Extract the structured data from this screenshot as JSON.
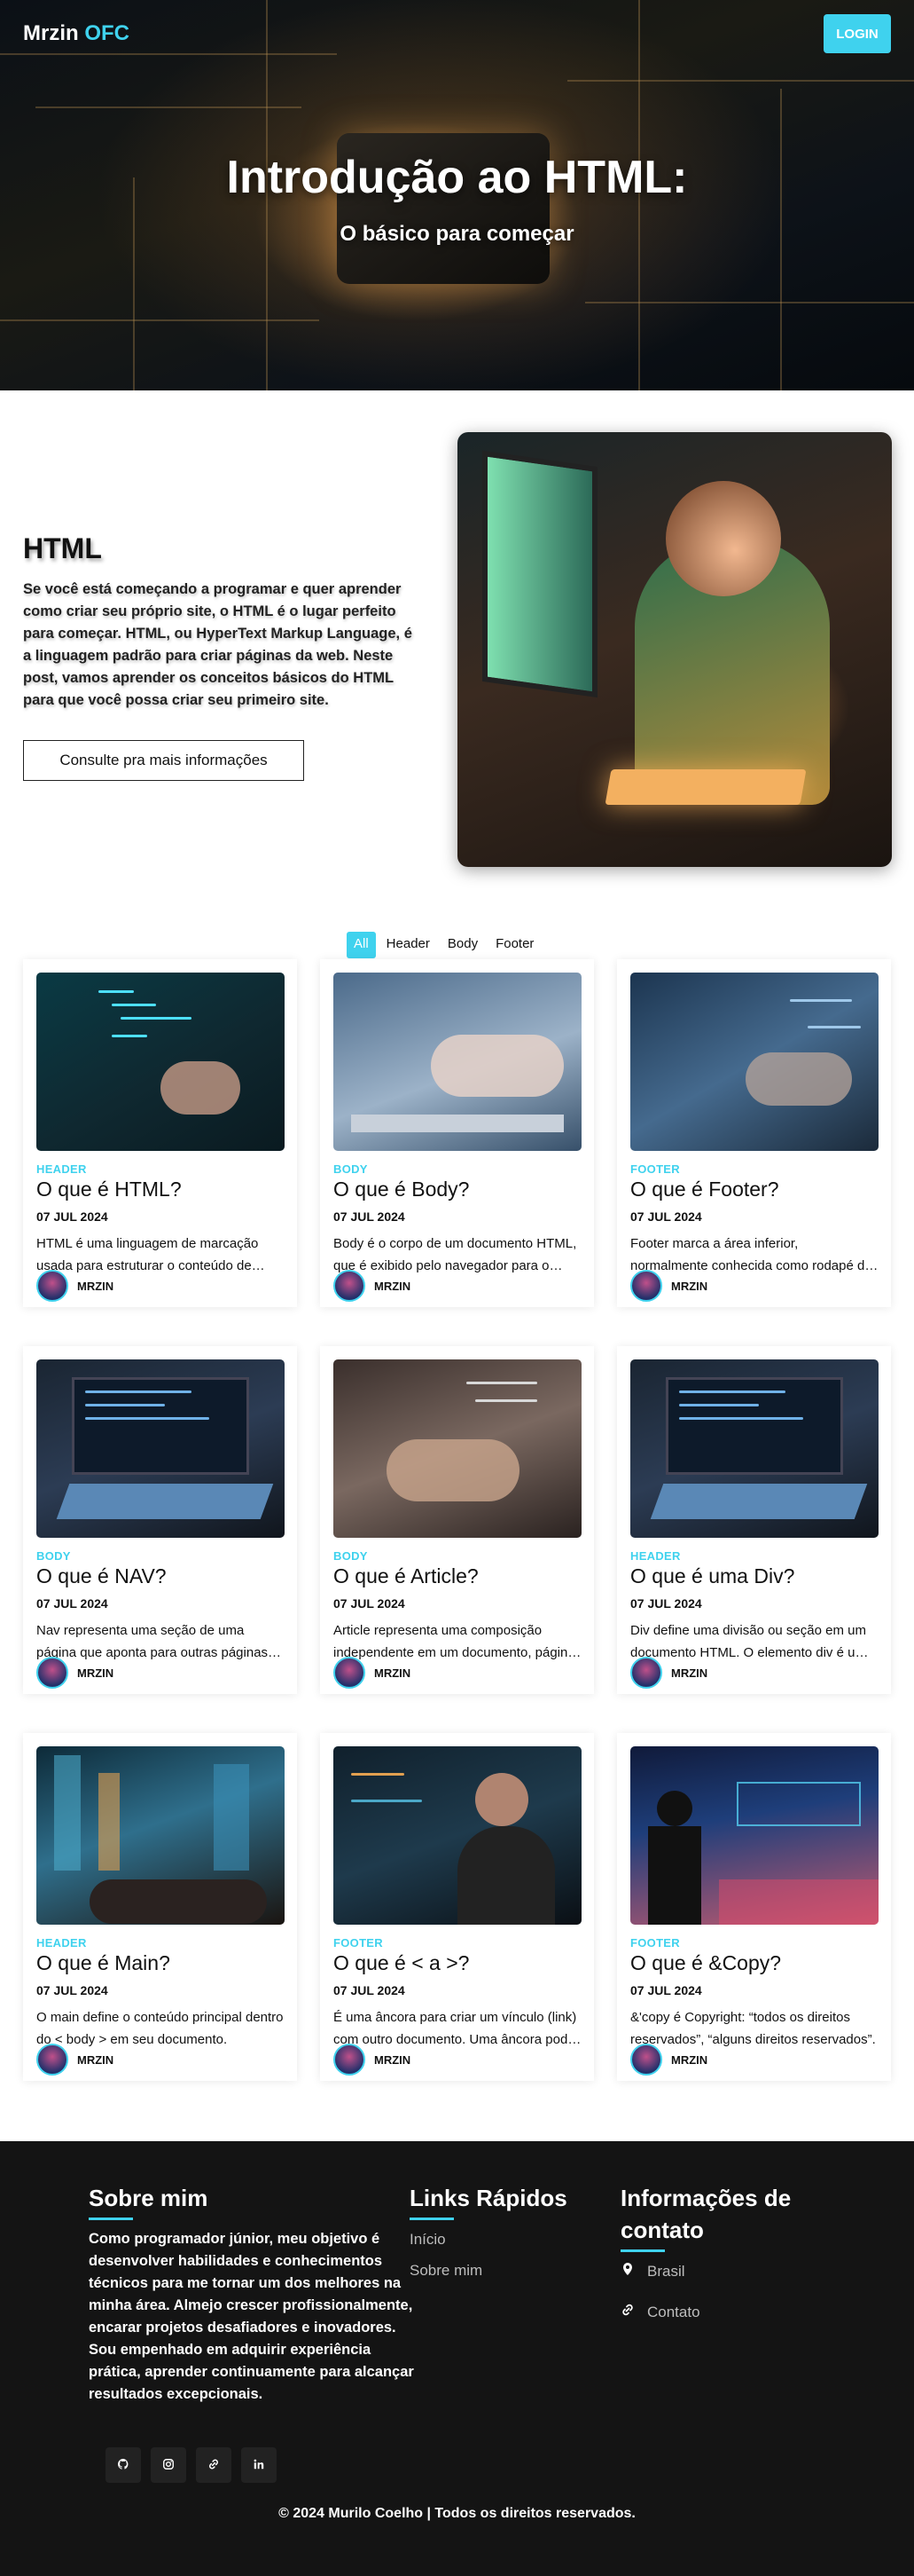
{
  "nav": {
    "brand_main": "Mrzin",
    "brand_accent": "OFC",
    "login_label": "LOGIN"
  },
  "hero": {
    "title": "Introdução ao HTML:",
    "subtitle": "O básico para começar"
  },
  "intro": {
    "heading": "HTML",
    "text": "Se você está começando a programar e quer aprender como criar seu próprio site, o HTML é o lugar perfeito para começar. HTML, ou HyperText Markup Language, é a linguagem padrão para criar páginas da web. Neste post, vamos aprender os conceitos básicos do HTML para que você possa criar seu primeiro site.",
    "button_label": "Consulte pra mais informações"
  },
  "filters": [
    "All",
    "Header",
    "Body",
    "Footer"
  ],
  "active_filter": "All",
  "cards": [
    {
      "category": "HEADER",
      "title": "O que é HTML?",
      "date": "07 JUL 2024",
      "excerpt": "HTML é uma linguagem de marcação usada para estruturar o conteúdo de páginas da web.",
      "author": "MRZIN"
    },
    {
      "category": "BODY",
      "title": "O que é Body?",
      "date": "07 JUL 2024",
      "excerpt": "Body é o corpo de um documento HTML, que é exibido pelo navegador para o usuário.",
      "author": "MRZIN"
    },
    {
      "category": "FOOTER",
      "title": "O que é Footer?",
      "date": "07 JUL 2024",
      "excerpt": "Footer marca a área inferior, normalmente conhecida como rodapé da página.",
      "author": "MRZIN"
    },
    {
      "category": "BODY",
      "title": "O que é NAV?",
      "date": "07 JUL 2024",
      "excerpt": "Nav representa uma seção de uma página que aponta para outras páginas ou seções.",
      "author": "MRZIN"
    },
    {
      "category": "BODY",
      "title": "O que é Article?",
      "date": "07 JUL 2024",
      "excerpt": "Article representa uma composição independente em um documento, página ou site.",
      "author": "MRZIN"
    },
    {
      "category": "HEADER",
      "title": "O que é uma Div?",
      "date": "07 JUL 2024",
      "excerpt": "Div define uma divisão ou seção em um documento HTML. O elemento div é um contêiner.",
      "author": "MRZIN"
    },
    {
      "category": "HEADER",
      "title": "O que é Main?",
      "date": "07 JUL 2024",
      "excerpt": "O main define o conteúdo principal dentro do < body > em seu documento.",
      "author": "MRZIN"
    },
    {
      "category": "FOOTER",
      "title": "O que é < a >?",
      "date": "07 JUL 2024",
      "excerpt": "É uma âncora para criar um vínculo (link) com outro documento. Uma âncora pode apontar.",
      "author": "MRZIN"
    },
    {
      "category": "FOOTER",
      "title": "O que é &Copy?",
      "date": "07 JUL 2024",
      "excerpt": "&'copy é Copyright: “todos os direitos reservados”, “alguns direitos reservados”.",
      "author": "MRZIN"
    }
  ],
  "footer": {
    "about_title": "Sobre mim",
    "about_text": "Como programador júnior, meu objetivo é desenvolver habilidades e conhecimentos técnicos para me tornar um dos melhores na minha área. Almejo crescer profissionalmente, encarar projetos desafiadores e inovadores. Sou empenhado em adquirir experiência prática, aprender continuamente para alcançar resultados excepcionais.",
    "links_title": "Links Rápidos",
    "links": [
      "Início",
      "Sobre mim"
    ],
    "contact_title_line1": "Informações de",
    "contact_title_line2": "contato",
    "location": "Brasil",
    "contact_link": "Contato",
    "social_icons": [
      "github-icon",
      "instagram-icon",
      "link-icon",
      "linkedin-icon"
    ],
    "copyright": "© 2024 Murilo Coelho | Todos os direitos reservados."
  },
  "colors": {
    "accent": "#3fd2ee",
    "footer_bg": "#141414"
  }
}
